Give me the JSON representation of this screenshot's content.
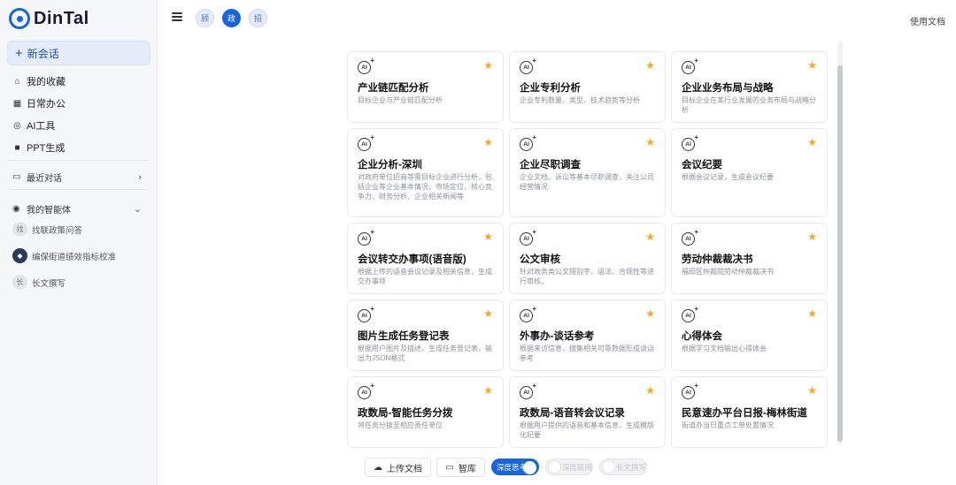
{
  "brand": {
    "name": "DinTal"
  },
  "sidebar": {
    "new_chat": "新会话",
    "nav": [
      {
        "label": "我的收藏",
        "icon": "home-icon"
      },
      {
        "label": "日常办公",
        "icon": "office-icon"
      },
      {
        "label": "AI工具",
        "icon": "ai-tool-icon"
      },
      {
        "label": "PPT生成",
        "icon": "ppt-icon"
      }
    ],
    "recent_label": "最近对话",
    "agents_label": "我的智能体",
    "agents": [
      {
        "avatar": "找",
        "label": "找联政策问答"
      },
      {
        "avatar": "",
        "label": "编保街道绩效指标校准"
      },
      {
        "avatar": "长",
        "label": "长文撰写"
      }
    ]
  },
  "header": {
    "chips": [
      "顾",
      "政",
      "招"
    ],
    "active_chip": 1,
    "docs_link": "使用文档"
  },
  "cards": [
    {
      "title": "产业链匹配分析",
      "desc": "目标企业与产业链匹配分析"
    },
    {
      "title": "企业专利分析",
      "desc": "企业专利数量、类型、技术趋势等分析"
    },
    {
      "title": "企业业务布局与战略",
      "desc": "目标企业在某行业发展的业务布局与战略分析"
    },
    {
      "title": "企业分析-深圳",
      "desc": "对政府单位招商等需目标企业进行分析，包括企业等企业基本情况、市场定位、核心竞争力、财务分析、企业相关新闻等"
    },
    {
      "title": "企业尽职调查",
      "desc": "企业文档、诉讼等基本尽职调查，关注公司经营情况"
    },
    {
      "title": "会议纪要",
      "desc": "根据会议记录，生成会议纪要"
    },
    {
      "title": "会议转交办事项(语音版)",
      "desc": "根据上传的语音会议记录及相关信息，生成交办事项"
    },
    {
      "title": "公文审核",
      "desc": "针对政务类公文错别字、语法、合规性等进行审核。"
    },
    {
      "title": "劳动仲裁裁决书",
      "desc": "福田区仲裁院劳动仲裁裁决书"
    },
    {
      "title": "图片生成任务登记表",
      "desc": "根据用户图片及描述，生成任务登记表，输出为JSON格式"
    },
    {
      "title": "外事办-谈话参考",
      "desc": "根据来访信息，搜集相关可靠数据形成谈话参考"
    },
    {
      "title": "心得体会",
      "desc": "根据学习文档输出心得体会"
    },
    {
      "title": "政数局-智能任务分拨",
      "desc": "将任务分拨至相应责任单位"
    },
    {
      "title": "政数局-语音转会议记录",
      "desc": "根据用户提供的语音和基本信息，生成模版化纪要"
    },
    {
      "title": "民意速办平台日报-梅林街道",
      "desc": "街道办当日重点工单处置情况"
    }
  ],
  "toolbar": {
    "upload": "上传文档",
    "library": "智库",
    "toggles": [
      {
        "label": "深度思考",
        "on": true
      },
      {
        "label": "深度联网",
        "on": false
      },
      {
        "label": "长文撰写",
        "on": false
      }
    ]
  },
  "colors": {
    "accent": "#1565e0",
    "star": "#f2a91b"
  }
}
